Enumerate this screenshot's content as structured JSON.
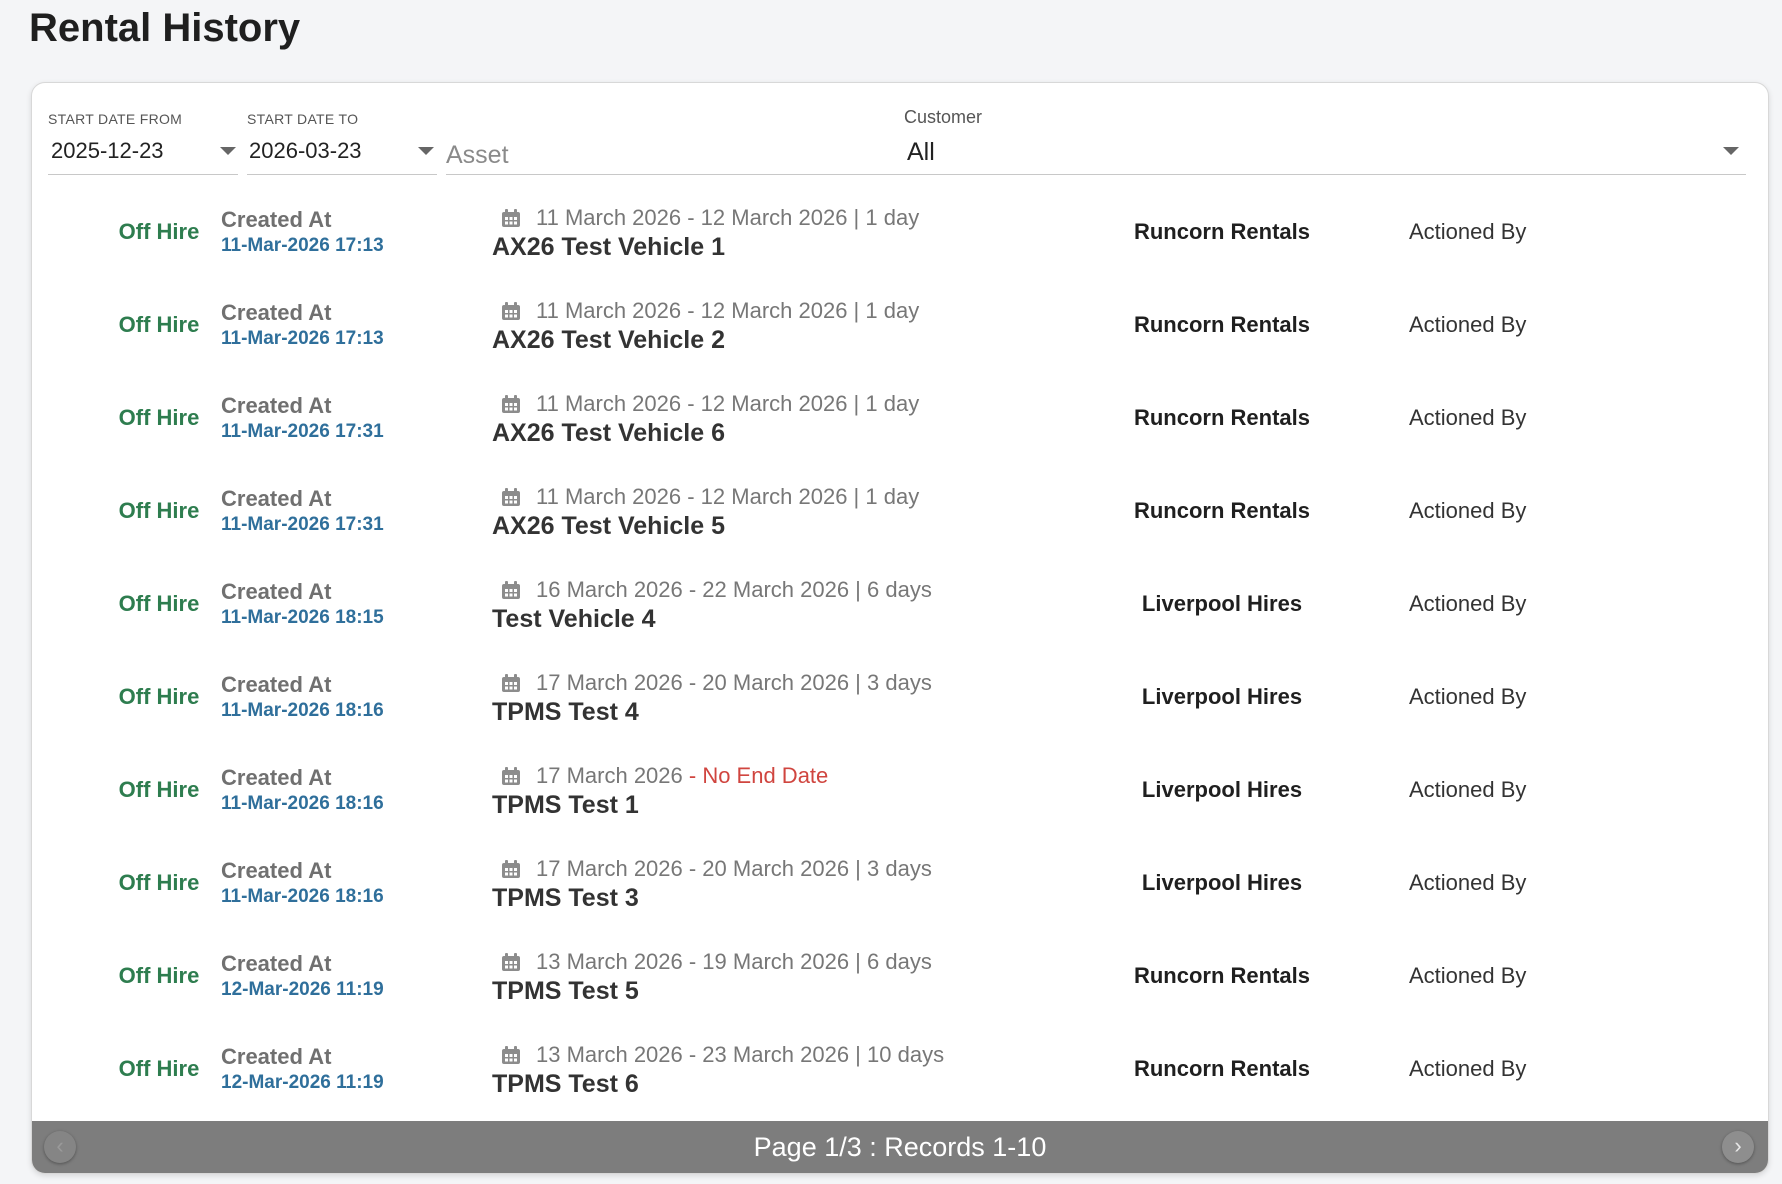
{
  "page": {
    "title": "Rental History"
  },
  "filters": {
    "start_from": {
      "label": "START DATE FROM",
      "value": "2025-12-23"
    },
    "start_to": {
      "label": "START DATE TO",
      "value": "2026-03-23"
    },
    "asset": {
      "placeholder": "Asset",
      "value": ""
    },
    "customer": {
      "label": "Customer",
      "value": "All"
    }
  },
  "rentals": [
    {
      "status": "Off Hire",
      "created_label": "Created At",
      "created_at": "11-Mar-2026 17:13",
      "dates": "11 March 2026 - 12 March 2026 | 1 day",
      "no_end": "",
      "asset": "AX26 Test Vehicle 1",
      "customer": "Runcorn Rentals",
      "actioned": "Actioned By"
    },
    {
      "status": "Off Hire",
      "created_label": "Created At",
      "created_at": "11-Mar-2026 17:13",
      "dates": "11 March 2026 - 12 March 2026 | 1 day",
      "no_end": "",
      "asset": "AX26 Test Vehicle 2",
      "customer": "Runcorn Rentals",
      "actioned": "Actioned By"
    },
    {
      "status": "Off Hire",
      "created_label": "Created At",
      "created_at": "11-Mar-2026 17:31",
      "dates": "11 March 2026 - 12 March 2026 | 1 day",
      "no_end": "",
      "asset": "AX26 Test Vehicle 6",
      "customer": "Runcorn Rentals",
      "actioned": "Actioned By"
    },
    {
      "status": "Off Hire",
      "created_label": "Created At",
      "created_at": "11-Mar-2026 17:31",
      "dates": "11 March 2026 - 12 March 2026 | 1 day",
      "no_end": "",
      "asset": "AX26 Test Vehicle 5",
      "customer": "Runcorn Rentals",
      "actioned": "Actioned By"
    },
    {
      "status": "Off Hire",
      "created_label": "Created At",
      "created_at": "11-Mar-2026 18:15",
      "dates": "16 March 2026 - 22 March 2026 | 6 days",
      "no_end": "",
      "asset": "Test Vehicle 4",
      "customer": "Liverpool Hires",
      "actioned": "Actioned By"
    },
    {
      "status": "Off Hire",
      "created_label": "Created At",
      "created_at": "11-Mar-2026 18:16",
      "dates": "17 March 2026 - 20 March 2026 | 3 days",
      "no_end": "",
      "asset": "TPMS Test 4",
      "customer": "Liverpool Hires",
      "actioned": "Actioned By"
    },
    {
      "status": "Off Hire",
      "created_label": "Created At",
      "created_at": "11-Mar-2026 18:16",
      "dates": "17 March 2026",
      "no_end": " - No End Date",
      "asset": "TPMS Test 1",
      "customer": "Liverpool Hires",
      "actioned": "Actioned By"
    },
    {
      "status": "Off Hire",
      "created_label": "Created At",
      "created_at": "11-Mar-2026 18:16",
      "dates": "17 March 2026 - 20 March 2026 | 3 days",
      "no_end": "",
      "asset": "TPMS Test 3",
      "customer": "Liverpool Hires",
      "actioned": "Actioned By"
    },
    {
      "status": "Off Hire",
      "created_label": "Created At",
      "created_at": "12-Mar-2026 11:19",
      "dates": "13 March 2026 - 19 March 2026 | 6 days",
      "no_end": "",
      "asset": "TPMS Test 5",
      "customer": "Runcorn Rentals",
      "actioned": "Actioned By"
    },
    {
      "status": "Off Hire",
      "created_label": "Created At",
      "created_at": "12-Mar-2026 11:19",
      "dates": "13 March 2026 - 23 March 2026 | 10 days",
      "no_end": "",
      "asset": "TPMS Test 6",
      "customer": "Runcorn Rentals",
      "actioned": "Actioned By"
    }
  ],
  "pagination": {
    "text": "Page 1/3 : Records 1-10",
    "prev_icon": "chevron-left-icon",
    "next_icon": "chevron-right-icon"
  },
  "colors": {
    "status_green": "#2e7d4f",
    "created_blue": "#2f6f9b",
    "no_end_red": "#d0453f",
    "pager_bg": "#7d7d7d"
  }
}
